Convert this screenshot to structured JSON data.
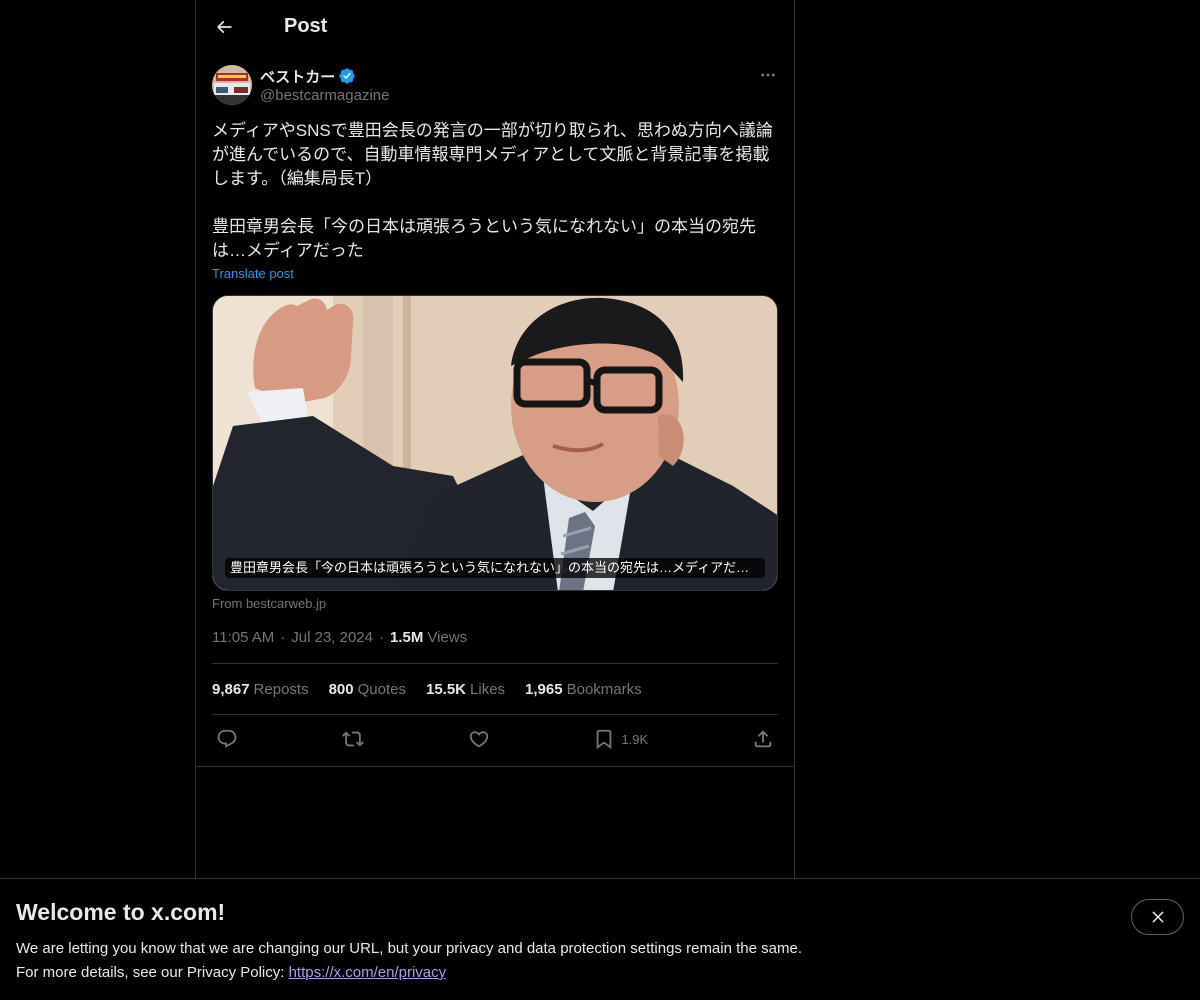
{
  "header": {
    "title": "Post"
  },
  "author": {
    "display_name": "ベストカー",
    "handle": "@bestcarmagazine",
    "verified_color": "#1d9bf0"
  },
  "post": {
    "text": "メディアやSNSで豊田会長の発言の一部が切り取られ、思わぬ方向へ議論が進んでいるので、自動車情報専門メディアとして文脈と背景記事を掲載します。（編集局長T）\n\n豊田章男会長「今の日本は頑張ろうという気になれない」の本当の宛先は…メディアだった",
    "translate_label": "Translate post",
    "time": "11:05 AM",
    "date": "Jul 23, 2024",
    "views_count": "1.5M",
    "views_label": "Views"
  },
  "card": {
    "caption": "豊田章男会長「今の日本は頑張ろうという気になれない」の本当の宛先は…メディアだっ…",
    "source": "From bestcarweb.jp"
  },
  "stats": [
    {
      "count": "9,867",
      "label": "Reposts"
    },
    {
      "count": "800",
      "label": "Quotes"
    },
    {
      "count": "15.5K",
      "label": "Likes"
    },
    {
      "count": "1,965",
      "label": "Bookmarks"
    }
  ],
  "actions": {
    "reply": "reply-icon",
    "repost": "repost-icon",
    "like": "heart-icon",
    "bookmark": "bookmark-icon",
    "bookmark_count": "1.9K",
    "share": "share-icon"
  },
  "banner": {
    "title": "Welcome to x.com!",
    "line1": "We are letting you know that we are changing our URL, but your privacy and data protection settings remain the same.",
    "line2_prefix": "For more details, see our Privacy Policy: ",
    "link": "https://x.com/en/privacy"
  }
}
